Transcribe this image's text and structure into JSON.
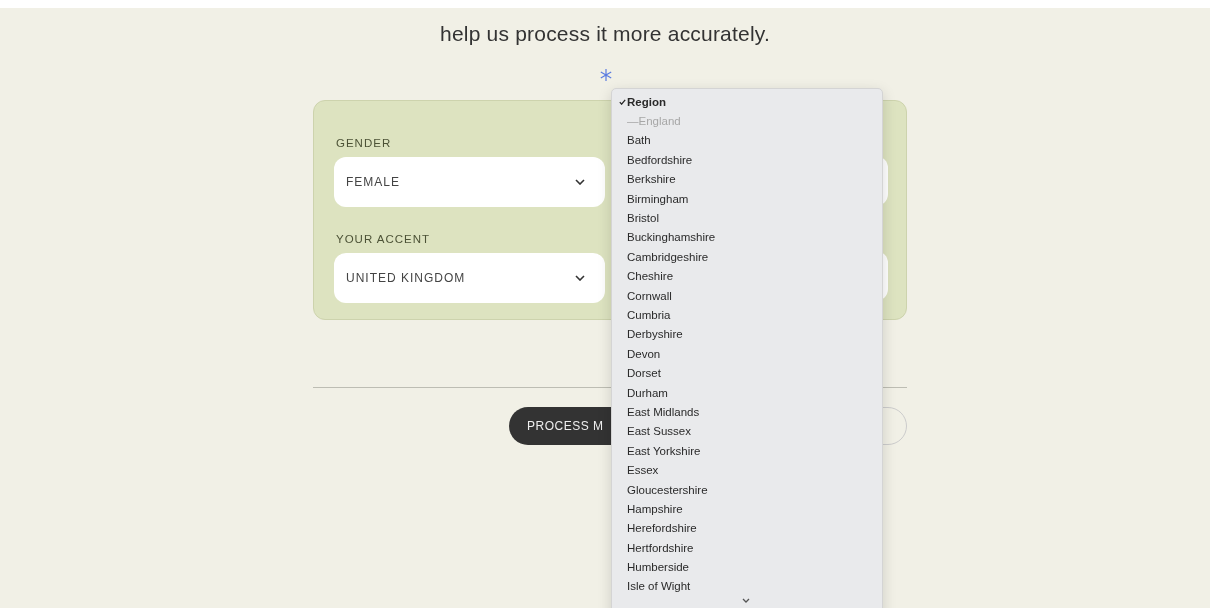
{
  "intro": {
    "text": "help us process it more accurately."
  },
  "form": {
    "left": [
      {
        "label": "GENDER",
        "value": "FEMALE"
      },
      {
        "label": "YOUR ACCENT",
        "value": "UNITED KINGDOM"
      }
    ]
  },
  "buttons": {
    "primary": "PROCESS M"
  },
  "region_menu": {
    "items": [
      {
        "label": "Region",
        "selected": true,
        "disabled": false
      },
      {
        "label": "—England",
        "selected": false,
        "disabled": true
      },
      {
        "label": "Bath",
        "selected": false,
        "disabled": false
      },
      {
        "label": "Bedfordshire",
        "selected": false,
        "disabled": false
      },
      {
        "label": "Berkshire",
        "selected": false,
        "disabled": false
      },
      {
        "label": "Birmingham",
        "selected": false,
        "disabled": false
      },
      {
        "label": "Bristol",
        "selected": false,
        "disabled": false
      },
      {
        "label": "Buckinghamshire",
        "selected": false,
        "disabled": false
      },
      {
        "label": "Cambridgeshire",
        "selected": false,
        "disabled": false
      },
      {
        "label": "Cheshire",
        "selected": false,
        "disabled": false
      },
      {
        "label": "Cornwall",
        "selected": false,
        "disabled": false
      },
      {
        "label": "Cumbria",
        "selected": false,
        "disabled": false
      },
      {
        "label": "Derbyshire",
        "selected": false,
        "disabled": false
      },
      {
        "label": "Devon",
        "selected": false,
        "disabled": false
      },
      {
        "label": "Dorset",
        "selected": false,
        "disabled": false
      },
      {
        "label": "Durham",
        "selected": false,
        "disabled": false
      },
      {
        "label": "East Midlands",
        "selected": false,
        "disabled": false
      },
      {
        "label": "East Sussex",
        "selected": false,
        "disabled": false
      },
      {
        "label": "East Yorkshire",
        "selected": false,
        "disabled": false
      },
      {
        "label": "Essex",
        "selected": false,
        "disabled": false
      },
      {
        "label": "Gloucestershire",
        "selected": false,
        "disabled": false
      },
      {
        "label": "Hampshire",
        "selected": false,
        "disabled": false
      },
      {
        "label": "Herefordshire",
        "selected": false,
        "disabled": false
      },
      {
        "label": "Hertfordshire",
        "selected": false,
        "disabled": false
      },
      {
        "label": "Humberside",
        "selected": false,
        "disabled": false
      },
      {
        "label": "Isle of Wight",
        "selected": false,
        "disabled": false
      }
    ]
  }
}
